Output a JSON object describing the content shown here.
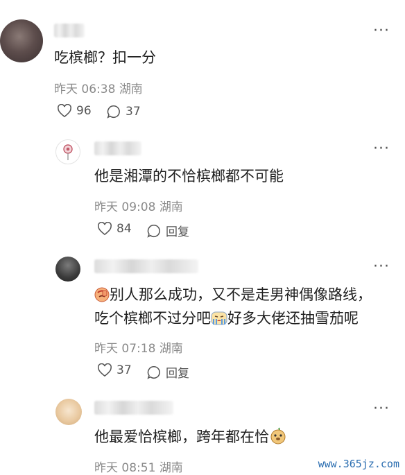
{
  "comments": [
    {
      "text_lines": [
        "吃槟榔？扣一分"
      ],
      "time": "昨天 06:38",
      "location": "湖南",
      "likes": "96",
      "replies": "37"
    },
    {
      "text_lines": [
        "他是湘潭的不恰槟榔都不可能"
      ],
      "time": "昨天 09:08",
      "location": "湖南",
      "likes": "84",
      "reply_label": "回复"
    },
    {
      "text_lines": [
        "别人那么成功，又不是走男神偶像路线，",
        "吃个槟榔不过分吧",
        "好多大佬还抽雪茄呢"
      ],
      "emojis": [
        "facepalm-emoji",
        "crying-emoji"
      ],
      "time": "昨天 07:18",
      "location": "湖南",
      "likes": "37",
      "reply_label": "回复"
    },
    {
      "text_lines": [
        "他最爱恰槟榔，跨年都在恰"
      ],
      "emojis": [
        "doge-emoji"
      ],
      "time": "昨天 08:51",
      "location": "湖南"
    }
  ],
  "more_label": "···",
  "watermark": "www.365jz.com",
  "colors": {
    "meta": "#8a8a8a",
    "watermark": "#2a6db0"
  }
}
